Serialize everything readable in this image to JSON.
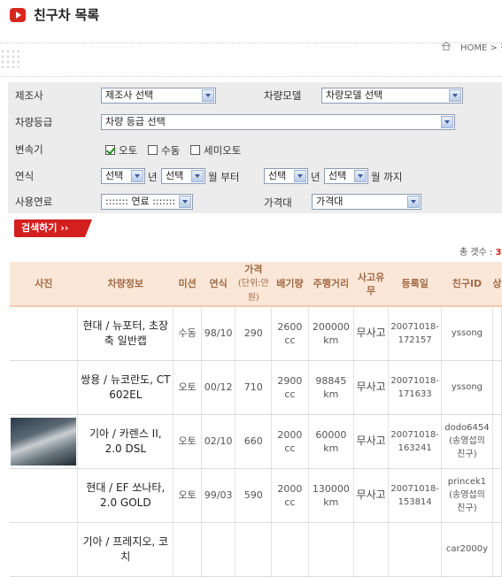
{
  "page": {
    "title": "친구차 목록",
    "breadcrumb": "HOME > 친"
  },
  "search": {
    "maker_label": "제조사",
    "maker_value": "제조사 선택",
    "model_label": "차량모델",
    "model_value": "차량모델 선택",
    "grade_label": "차량등급",
    "grade_value": "차량 등급 선택",
    "transmission_label": "변속기",
    "transmission_options": [
      {
        "label": "오토",
        "checked": true
      },
      {
        "label": "수동",
        "checked": false
      },
      {
        "label": "세미오토",
        "checked": false
      }
    ],
    "year_label": "연식",
    "select_placeholder": "선택",
    "year_unit": "년",
    "month_unit_from": "월 부터",
    "month_unit_to": "월 까지",
    "fuel_label": "사용연료",
    "fuel_value": "::::::: 연료 :::::::",
    "price_label": "가격대",
    "price_value": "가격대",
    "button_label": "검색하기 ››"
  },
  "results": {
    "count_label": "총 갯수 : ",
    "count_value": "3",
    "headers": [
      "사진",
      "차량정보",
      "미션",
      "연식",
      "가격",
      "(단위:만원)",
      "배기량",
      "주행거리",
      "사고유무",
      "등록일",
      "친구ID",
      "상"
    ],
    "rows": [
      {
        "photo": false,
        "info": "현대 / 뉴포터, 초장축 일반캡",
        "mission": "수동",
        "year": "98/10",
        "price": "290",
        "displacement": "2600 cc",
        "mileage": "200000 km",
        "accident": "무사고",
        "registered": "20071018-172157",
        "friend_id": "yssong"
      },
      {
        "photo": false,
        "info": "쌍용 / 뉴코란도, CT 602EL",
        "mission": "오토",
        "year": "00/12",
        "price": "710",
        "displacement": "2900 cc",
        "mileage": "98845 km",
        "accident": "무사고",
        "registered": "20071018-171633",
        "friend_id": "yssong"
      },
      {
        "photo": true,
        "info": "기아 / 카렌스 II, 2.0 DSL",
        "mission": "오토",
        "year": "02/10",
        "price": "660",
        "displacement": "2000 cc",
        "mileage": "60000 km",
        "accident": "무사고",
        "registered": "20071018-163241",
        "friend_id": "dodo6454 (송영섭의 친구)"
      },
      {
        "photo": false,
        "info": "현대 / EF 쏘나타, 2.0 GOLD",
        "mission": "오토",
        "year": "99/03",
        "price": "590",
        "displacement": "2000 cc",
        "mileage": "130000 km",
        "accident": "무사고",
        "registered": "20071018-153814",
        "friend_id": "princek1 (송영섭의 친구)"
      },
      {
        "photo": false,
        "info": "기아 / 프레지오, 코치",
        "mission": "",
        "year": "",
        "price": "",
        "displacement": "",
        "mileage": "",
        "accident": "",
        "registered": "",
        "friend_id": "car2000y"
      }
    ]
  },
  "colors": {
    "accent": "#d41f1f",
    "panel_bg": "#ececec",
    "header_bg": "#fbe7d8",
    "header_text": "#a06a44"
  },
  "icons": [
    "play-icon",
    "home-icon",
    "chevron-down-icon",
    "checkbox-icon"
  ]
}
